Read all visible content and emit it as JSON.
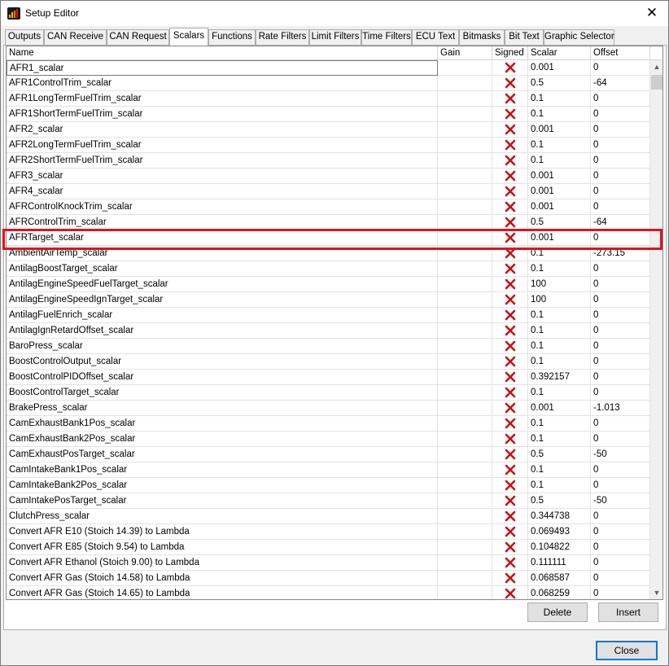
{
  "window": {
    "title": "Setup Editor",
    "close_glyph": "✕"
  },
  "tabs": [
    {
      "label": "Outputs"
    },
    {
      "label": "CAN Receive"
    },
    {
      "label": "CAN Request"
    },
    {
      "label": "Scalars",
      "active": true
    },
    {
      "label": "Functions"
    },
    {
      "label": "Rate Filters"
    },
    {
      "label": "Limit Filters"
    },
    {
      "label": "Time Filters"
    },
    {
      "label": "ECU Text"
    },
    {
      "label": "Bitmasks"
    },
    {
      "label": "Bit Text"
    },
    {
      "label": "Graphic Selector"
    }
  ],
  "table": {
    "columns": [
      "Name",
      "Gain",
      "Signed",
      "Scalar",
      "Offset"
    ],
    "signed_icon": "red-x-icon",
    "rows": [
      {
        "name": "AFR1_scalar",
        "gain": "",
        "scalar": "0.001",
        "offset": "0"
      },
      {
        "name": "AFR1ControlTrim_scalar",
        "gain": "",
        "scalar": "0.5",
        "offset": "-64"
      },
      {
        "name": "AFR1LongTermFuelTrim_scalar",
        "gain": "",
        "scalar": "0.1",
        "offset": "0"
      },
      {
        "name": "AFR1ShortTermFuelTrim_scalar",
        "gain": "",
        "scalar": "0.1",
        "offset": "0"
      },
      {
        "name": "AFR2_scalar",
        "gain": "",
        "scalar": "0.001",
        "offset": "0"
      },
      {
        "name": "AFR2LongTermFuelTrim_scalar",
        "gain": "",
        "scalar": "0.1",
        "offset": "0"
      },
      {
        "name": "AFR2ShortTermFuelTrim_scalar",
        "gain": "",
        "scalar": "0.1",
        "offset": "0"
      },
      {
        "name": "AFR3_scalar",
        "gain": "",
        "scalar": "0.001",
        "offset": "0"
      },
      {
        "name": "AFR4_scalar",
        "gain": "",
        "scalar": "0.001",
        "offset": "0"
      },
      {
        "name": "AFRControlKnockTrim_scalar",
        "gain": "",
        "scalar": "0.001",
        "offset": "0"
      },
      {
        "name": "AFRControlTrim_scalar",
        "gain": "",
        "scalar": "0.5",
        "offset": "-64"
      },
      {
        "name": "AFRTarget_scalar",
        "gain": "",
        "scalar": "0.001",
        "offset": "0"
      },
      {
        "name": "AmbientAirTemp_scalar",
        "gain": "",
        "scalar": "0.1",
        "offset": "-273.15"
      },
      {
        "name": "AntilagBoostTarget_scalar",
        "gain": "",
        "scalar": "0.1",
        "offset": "0"
      },
      {
        "name": "AntilagEngineSpeedFuelTarget_scalar",
        "gain": "",
        "scalar": "100",
        "offset": "0"
      },
      {
        "name": "AntilagEngineSpeedIgnTarget_scalar",
        "gain": "",
        "scalar": "100",
        "offset": "0"
      },
      {
        "name": "AntilagFuelEnrich_scalar",
        "gain": "",
        "scalar": "0.1",
        "offset": "0"
      },
      {
        "name": "AntilagIgnRetardOffset_scalar",
        "gain": "",
        "scalar": "0.1",
        "offset": "0"
      },
      {
        "name": "BaroPress_scalar",
        "gain": "",
        "scalar": "0.1",
        "offset": "0"
      },
      {
        "name": "BoostControlOutput_scalar",
        "gain": "",
        "scalar": "0.1",
        "offset": "0"
      },
      {
        "name": "BoostControlPIDOffset_scalar",
        "gain": "",
        "scalar": "0.392157",
        "offset": "0"
      },
      {
        "name": "BoostControlTarget_scalar",
        "gain": "",
        "scalar": "0.1",
        "offset": "0"
      },
      {
        "name": "BrakePress_scalar",
        "gain": "",
        "scalar": "0.001",
        "offset": "-1.013"
      },
      {
        "name": "CamExhaustBank1Pos_scalar",
        "gain": "",
        "scalar": "0.1",
        "offset": "0"
      },
      {
        "name": "CamExhaustBank2Pos_scalar",
        "gain": "",
        "scalar": "0.1",
        "offset": "0"
      },
      {
        "name": "CamExhaustPosTarget_scalar",
        "gain": "",
        "scalar": "0.5",
        "offset": "-50"
      },
      {
        "name": "CamIntakeBank1Pos_scalar",
        "gain": "",
        "scalar": "0.1",
        "offset": "0"
      },
      {
        "name": "CamIntakeBank2Pos_scalar",
        "gain": "",
        "scalar": "0.1",
        "offset": "0"
      },
      {
        "name": "CamIntakePosTarget_scalar",
        "gain": "",
        "scalar": "0.5",
        "offset": "-50"
      },
      {
        "name": "ClutchPress_scalar",
        "gain": "",
        "scalar": "0.344738",
        "offset": "0"
      },
      {
        "name": "Convert AFR E10 (Stoich 14.39) to Lambda",
        "gain": "",
        "scalar": "0.069493",
        "offset": "0"
      },
      {
        "name": "Convert AFR E85 (Stoich 9.54) to Lambda",
        "gain": "",
        "scalar": "0.104822",
        "offset": "0"
      },
      {
        "name": "Convert AFR Ethanol (Stoich 9.00) to Lambda",
        "gain": "",
        "scalar": "0.111111",
        "offset": "0"
      },
      {
        "name": "Convert AFR Gas (Stoich 14.58) to Lambda",
        "gain": "",
        "scalar": "0.068587",
        "offset": "0"
      },
      {
        "name": "Convert AFR Gas (Stoich 14.65) to Lambda",
        "gain": "",
        "scalar": "0.068259",
        "offset": "0"
      }
    ]
  },
  "buttons": {
    "delete": "Delete",
    "insert": "Insert",
    "close": "Close"
  },
  "colors": {
    "highlight": "#e0131e",
    "signed_x": "#c8101a"
  }
}
